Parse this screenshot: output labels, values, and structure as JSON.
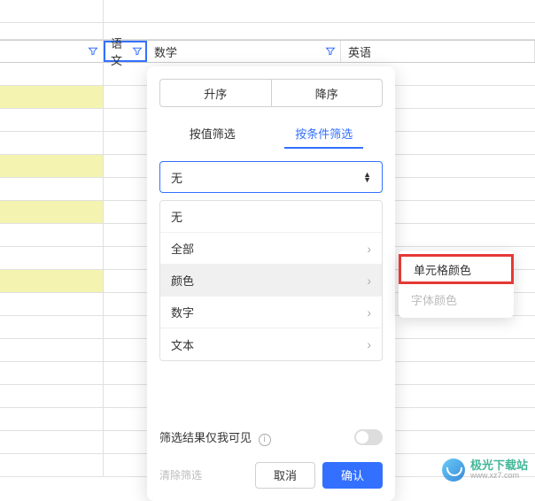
{
  "columns": {
    "c2": "语文",
    "c3": "数学",
    "c4": "英语"
  },
  "panel": {
    "sort_asc": "升序",
    "sort_desc": "降序",
    "tab_value": "按值筛选",
    "tab_condition": "按条件筛选",
    "select_value": "无",
    "options": {
      "none": "无",
      "all": "全部",
      "color": "颜色",
      "number": "数字",
      "text": "文本"
    },
    "visible_only": "筛选结果仅我可见",
    "clear": "清除筛选",
    "cancel": "取消",
    "confirm": "确认"
  },
  "submenu": {
    "cell_color": "单元格颜色",
    "font_color": "字体颜色"
  },
  "watermark": {
    "name": "极光下载站",
    "url": "www.xz7.com"
  }
}
